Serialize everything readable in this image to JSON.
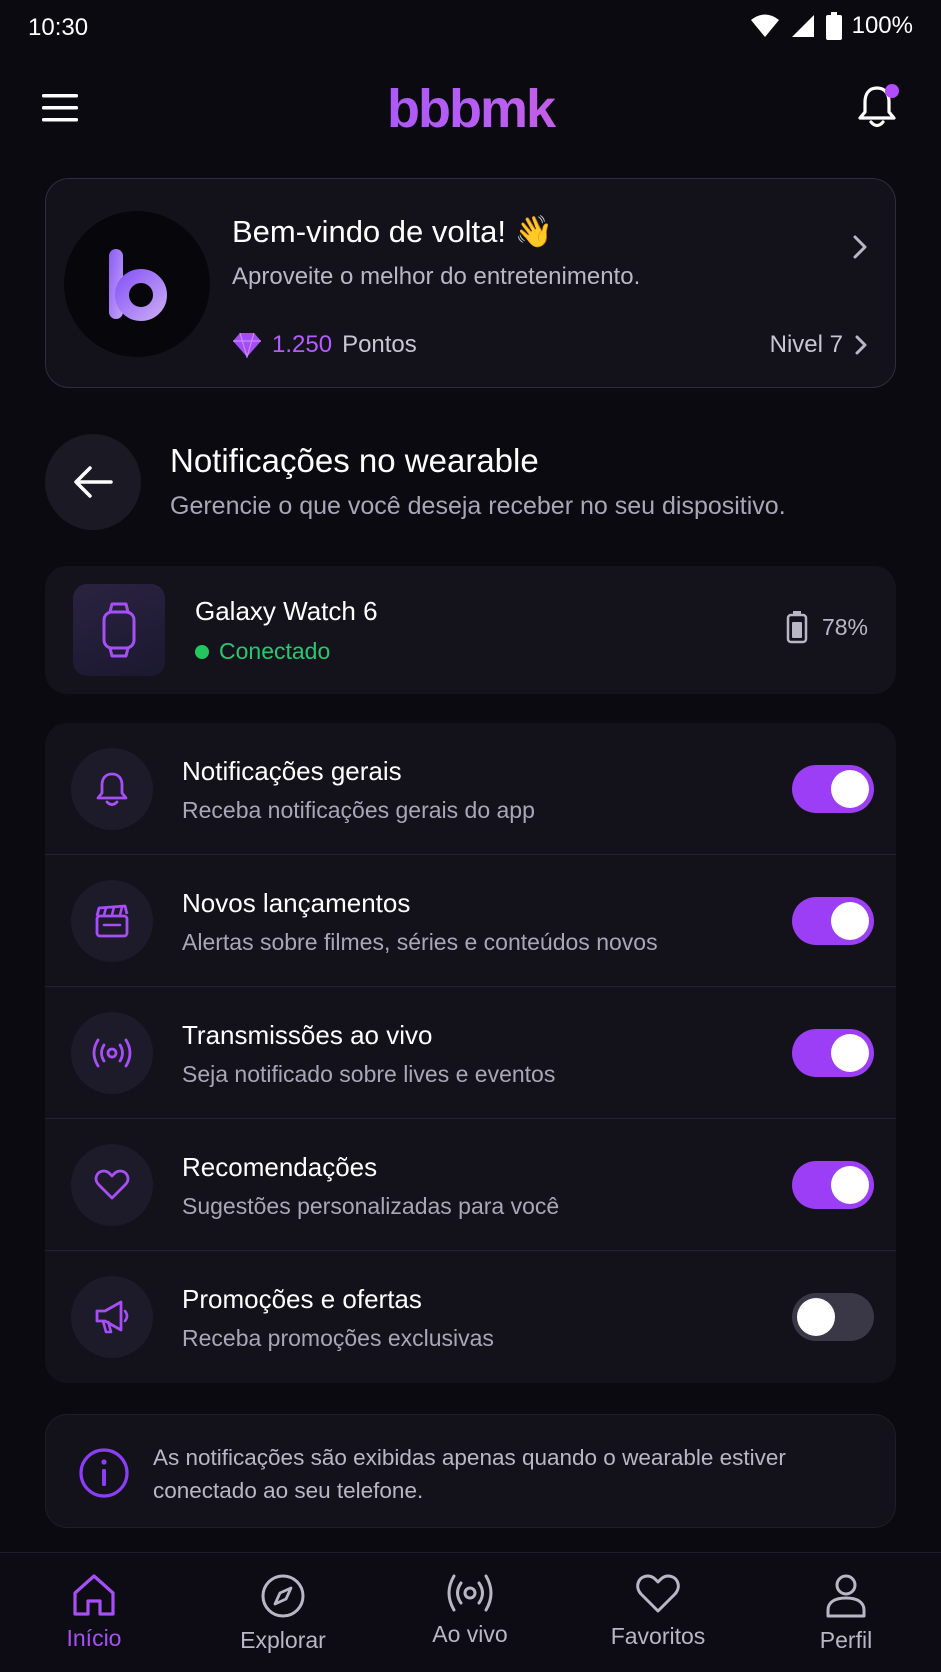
{
  "status_bar": {
    "time": "10:30",
    "battery": "100%"
  },
  "header": {
    "logo": "bbbmk"
  },
  "welcome": {
    "avatar_letter": "b",
    "title": "Bem-vindo de volta! 👋",
    "subtitle": "Aproveite o melhor do entretenimento.",
    "points_value": "1.250",
    "points_label": "Pontos",
    "level": "Nivel 7"
  },
  "section": {
    "title": "Notificações no wearable",
    "subtitle": "Gerencie o que você deseja receber no seu dispositivo."
  },
  "device": {
    "name": "Galaxy Watch 6",
    "status": "Conectado",
    "battery": "78%"
  },
  "settings": [
    {
      "icon": "bell-icon",
      "title": "Notificações gerais",
      "description": "Receba notificações gerais do app",
      "enabled": true
    },
    {
      "icon": "clapperboard-icon",
      "title": "Novos lançamentos",
      "description": "Alertas sobre filmes, séries e conteúdos novos",
      "enabled": true
    },
    {
      "icon": "broadcast-icon",
      "title": "Transmissões ao vivo",
      "description": "Seja notificado sobre lives e eventos",
      "enabled": true
    },
    {
      "icon": "heart-icon",
      "title": "Recomendações",
      "description": "Sugestões personalizadas para você",
      "enabled": true
    },
    {
      "icon": "megaphone-icon",
      "title": "Promoções e ofertas",
      "description": "Receba promoções exclusivas",
      "enabled": false
    }
  ],
  "info": {
    "text": "As notificações são exibidas apenas quando o wearable estiver conectado ao seu telefone."
  },
  "nav": [
    {
      "label": "Início",
      "icon": "home-icon",
      "active": true
    },
    {
      "label": "Explorar",
      "icon": "compass-icon",
      "active": false
    },
    {
      "label": "Ao vivo",
      "icon": "broadcast-icon",
      "active": false
    },
    {
      "label": "Favoritos",
      "icon": "heart-icon",
      "active": false
    },
    {
      "label": "Perfil",
      "icon": "user-icon",
      "active": false
    }
  ],
  "colors": {
    "accent": "#9b3ef5",
    "background": "#0b0a11",
    "card": "#13121b",
    "success": "#22c55e"
  }
}
